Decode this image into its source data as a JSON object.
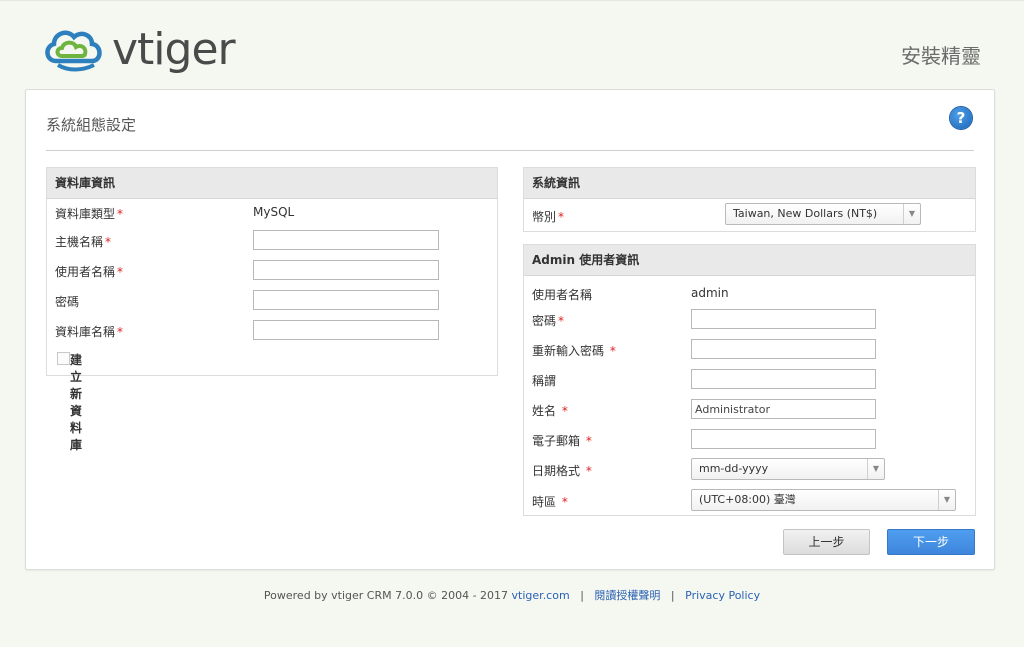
{
  "header": {
    "logo_text": "vtiger",
    "wizard_title": "安裝精靈"
  },
  "page": {
    "title": "系統組態設定",
    "help_glyph": "?"
  },
  "db_panel": {
    "title": "資料庫資訊",
    "type_label": "資料庫類型",
    "type_value": "MySQL",
    "host_label": "主機名稱",
    "host_value": "",
    "user_label": "使用者名稱",
    "user_value": "",
    "password_label": "密碼",
    "password_value": "",
    "dbname_label": "資料庫名稱",
    "dbname_value": "",
    "create_db_label": "建立新資料庫",
    "create_db_checked": false
  },
  "sys_panel": {
    "title": "系統資訊",
    "currency_label": "幣別",
    "currency_value": "Taiwan, New Dollars (NT$)"
  },
  "admin_panel": {
    "title": "Admin 使用者資訊",
    "username_label": "使用者名稱",
    "username_value": "admin",
    "password_label": "密碼",
    "password_value": "",
    "retype_label": "重新輸入密碼",
    "retype_value": "",
    "firstname_label": "稱謂",
    "firstname_value": "",
    "lastname_label": "姓名",
    "lastname_value": "Administrator",
    "email_label": "電子郵箱",
    "email_value": "",
    "dateformat_label": "日期格式",
    "dateformat_value": "mm-dd-yyyy",
    "timezone_label": "時區",
    "timezone_value": "(UTC+08:00) 臺灣"
  },
  "buttons": {
    "back": "上一步",
    "next": "下一步"
  },
  "required_mark": "*",
  "select_arrow": "▼",
  "footer": {
    "powered": "Powered by vtiger CRM 7.0.0  © 2004 - 2017 ",
    "link1": "vtiger.com",
    "sep": "|",
    "link2": "閱讀授權聲明",
    "link3": "Privacy Policy"
  },
  "colors": {
    "accent_blue": "#3e86dc",
    "required_red": "#dd2222",
    "background": "#f4f8f0"
  },
  "icons": {
    "help": "help-circle-icon",
    "checkbox": "checkbox-icon",
    "dropdown": "chevron-down-icon",
    "logo": "vtiger-cloud-logo-icon"
  }
}
